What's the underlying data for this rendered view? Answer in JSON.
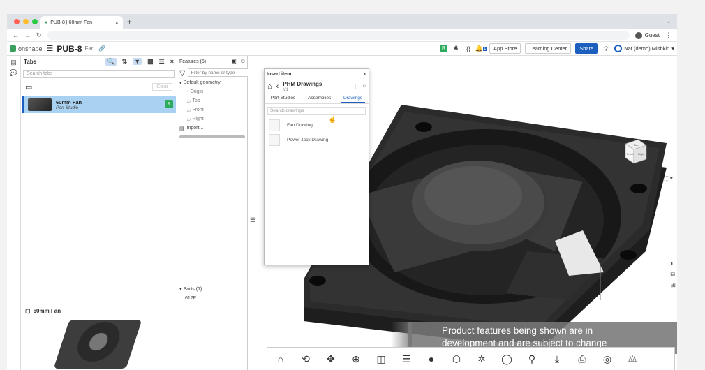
{
  "browser": {
    "tab_title": "PUB-8 | 60mm Fan",
    "tab_close": "×",
    "new_tab": "+",
    "profile_label": "Guest"
  },
  "header": {
    "logo_text": "onshape",
    "doc_name": "PUB-8",
    "doc_sub": "Fan",
    "app_store": "App Store",
    "learning_center": "Learning Center",
    "share": "Share",
    "user_name": "Nat (demo) Mishkin",
    "notification_count": "1"
  },
  "tabs_panel": {
    "title": "Tabs",
    "search_placeholder": "Search tabs",
    "clear_label": "Clear",
    "items": [
      {
        "name": "60mm Fan",
        "type": "Part Studio"
      }
    ],
    "preview_title": "60mm Fan"
  },
  "features": {
    "title": "Features (5)",
    "filter_placeholder": "Filter by name or type",
    "tree": {
      "default_geometry": "Default geometry",
      "origin": "Origin",
      "top": "Top",
      "front": "Front",
      "right": "Right",
      "import": "Import 1"
    },
    "parts_title": "Parts (1)",
    "parts": [
      "612F"
    ]
  },
  "insert_dialog": {
    "title": "Insert item",
    "doc_name": "PHM Drawings",
    "version": "V1",
    "tabs": [
      "Part Studios",
      "Assemblies",
      "Drawings"
    ],
    "active_tab": "Drawings",
    "search_placeholder": "Search drawings",
    "items": [
      "Fan Drawing",
      "Power Jack Drawing"
    ]
  },
  "view_cube": {
    "top": "Top",
    "front": "Front",
    "right": "Right"
  },
  "banner": {
    "line1": "Product features being shown are in",
    "line2": "development and are subject to change"
  },
  "colors": {
    "accent": "#1d5fbf",
    "green": "#2eaa5c"
  }
}
